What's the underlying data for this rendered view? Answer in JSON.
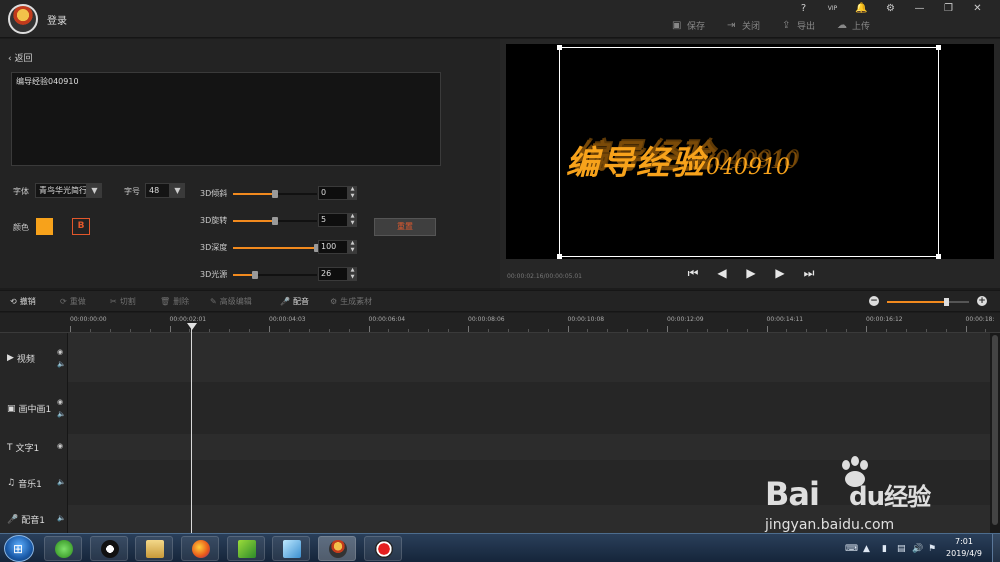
{
  "titlebar": {
    "login": "登录",
    "help": "?",
    "vip": "VIP",
    "bell": "🔔",
    "gear": "⚙",
    "min": "—",
    "max": "❐",
    "close": "✕",
    "toolbar": [
      {
        "label": "保存",
        "icon": "save-icon"
      },
      {
        "label": "关闭",
        "icon": "exit-icon"
      },
      {
        "label": "导出",
        "icon": "export-icon"
      },
      {
        "label": "上传",
        "icon": "upload-icon"
      }
    ]
  },
  "editor": {
    "back": "返回",
    "text_value": "编导经验040910",
    "font_label": "字体",
    "font_value": "青鸟华光简行",
    "size_label": "字号",
    "size_value": "48",
    "color_label": "颜色",
    "color_value": "#f7a21b",
    "bold_label": "B",
    "reset_label": "重置",
    "sliders": [
      {
        "label": "3D倾斜",
        "value": "0",
        "fraction": 0.5
      },
      {
        "label": "3D旋转",
        "value": "5",
        "fraction": 0.5
      },
      {
        "label": "3D深度",
        "value": "100",
        "fraction": 1.0
      },
      {
        "label": "3D光源",
        "value": "26",
        "fraction": 0.26
      }
    ]
  },
  "preview": {
    "text_main": "编导经验",
    "text_num": "040910",
    "timecode": "00:00:02.16/00:00:05.01",
    "controls": [
      "⏮",
      "◀",
      "▶",
      "▶",
      "⏭"
    ]
  },
  "timeline": {
    "tools": [
      {
        "label": "撤销",
        "icon": "undo-icon",
        "active": true
      },
      {
        "label": "重做",
        "icon": "redo-icon",
        "active": false
      },
      {
        "label": "切割",
        "icon": "scissors-icon",
        "active": false
      },
      {
        "label": "删除",
        "icon": "trash-icon",
        "active": false
      },
      {
        "label": "高级编辑",
        "icon": "pen-icon",
        "active": false
      },
      {
        "label": "配音",
        "icon": "mic-icon",
        "active": true
      },
      {
        "label": "生成素材",
        "icon": "generate-icon",
        "active": false
      }
    ],
    "zoom_fraction": 0.72,
    "ruler": [
      "00:00:00:00",
      "00:00:02:01",
      "00:00:04:03",
      "00:00:06:04",
      "00:00:08:06",
      "00:00:10:08",
      "00:00:12:09",
      "00:00:14:11",
      "00:00:16:12",
      "00:00:18:"
    ],
    "tracks": [
      {
        "name": "视频",
        "icon": "video-track-icon",
        "controls": [
          "eye",
          "speaker"
        ]
      },
      {
        "name": "画中画1",
        "icon": "pip-track-icon",
        "controls": [
          "eye",
          "speaker"
        ]
      },
      {
        "name": "文字1",
        "icon": "text-track-icon",
        "controls": [
          "eye"
        ]
      },
      {
        "name": "音乐1",
        "icon": "music-track-icon",
        "controls": [
          "speaker"
        ]
      },
      {
        "name": "配音1",
        "icon": "mic-track-icon",
        "controls": [
          "speaker"
        ]
      }
    ]
  },
  "watermark": {
    "brand": "Bai",
    "brand2": "du",
    "cn": "经验",
    "url": "jingyan.baidu.com"
  },
  "taskbar": {
    "time": "7:01",
    "date": "2019/4/9"
  },
  "colors": {
    "accent": "#f28a1e",
    "text_orange": "#f7a21b"
  }
}
